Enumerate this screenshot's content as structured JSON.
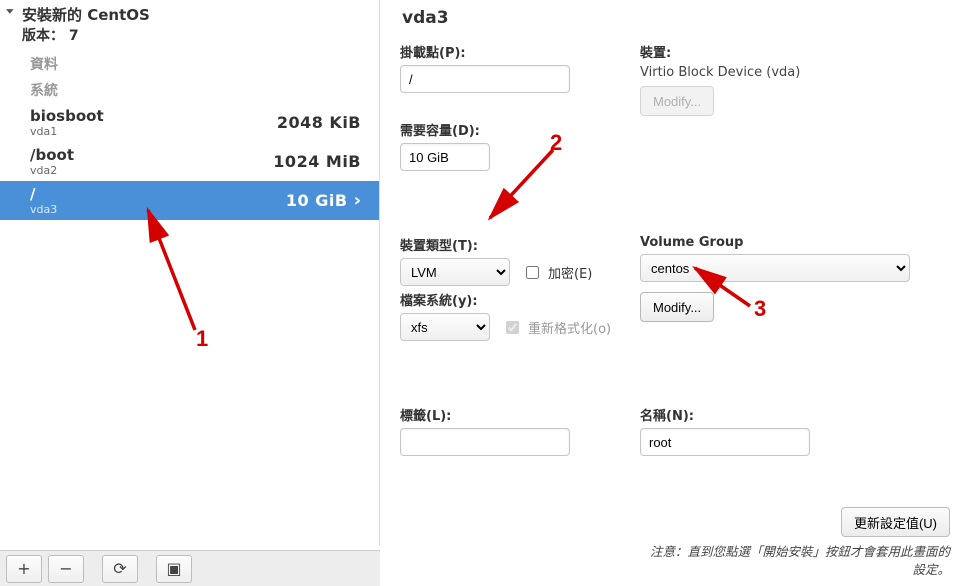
{
  "sidebar": {
    "title": "安裝新的 CentOS",
    "version_line": "版本： 7",
    "cat_data": "資料",
    "cat_system": "系統",
    "partitions": [
      {
        "name": "biosboot",
        "dev": "vda1",
        "size": "2048 KiB",
        "selected": false
      },
      {
        "name": "/boot",
        "dev": "vda2",
        "size": "1024 MiB",
        "selected": false
      },
      {
        "name": "/",
        "dev": "vda3",
        "size": "10 GiB",
        "selected": true
      }
    ]
  },
  "details": {
    "title": "vda3",
    "mount_label": "掛載點(P):",
    "mount_value": "/",
    "device_label": "裝置:",
    "device_value": "Virtio Block Device (vda)",
    "modify_device_label": "Modify...",
    "desired_label": "需要容量(D):",
    "desired_value": "10 GiB",
    "type_label": "裝置類型(T):",
    "type_value": "LVM",
    "type_options": [
      "LVM"
    ],
    "encrypt_label": "加密(E)",
    "encrypt_checked": false,
    "vg_label": "Volume Group",
    "vg_value": "centos",
    "vg_options": [
      "centos"
    ],
    "vg_modify_label": "Modify...",
    "fs_label": "檔案系統(y):",
    "fs_value": "xfs",
    "fs_options": [
      "xfs"
    ],
    "reformat_label": "重新格式化(o)",
    "reformat_checked": true,
    "label_label": "標籤(L):",
    "label_value": "",
    "name_label": "名稱(N):",
    "name_value": "root"
  },
  "footer": {
    "update_label": "更新設定值(U)",
    "note_line1": "注意：直到您點選「開始安裝」按鈕才會套用此畫面的",
    "note_line2": "設定。"
  },
  "toolbar": {
    "add": "+",
    "remove": "−",
    "refresh": "⟳",
    "help": "▣"
  },
  "annotations": {
    "n1": "1",
    "n2": "2",
    "n3": "3"
  }
}
